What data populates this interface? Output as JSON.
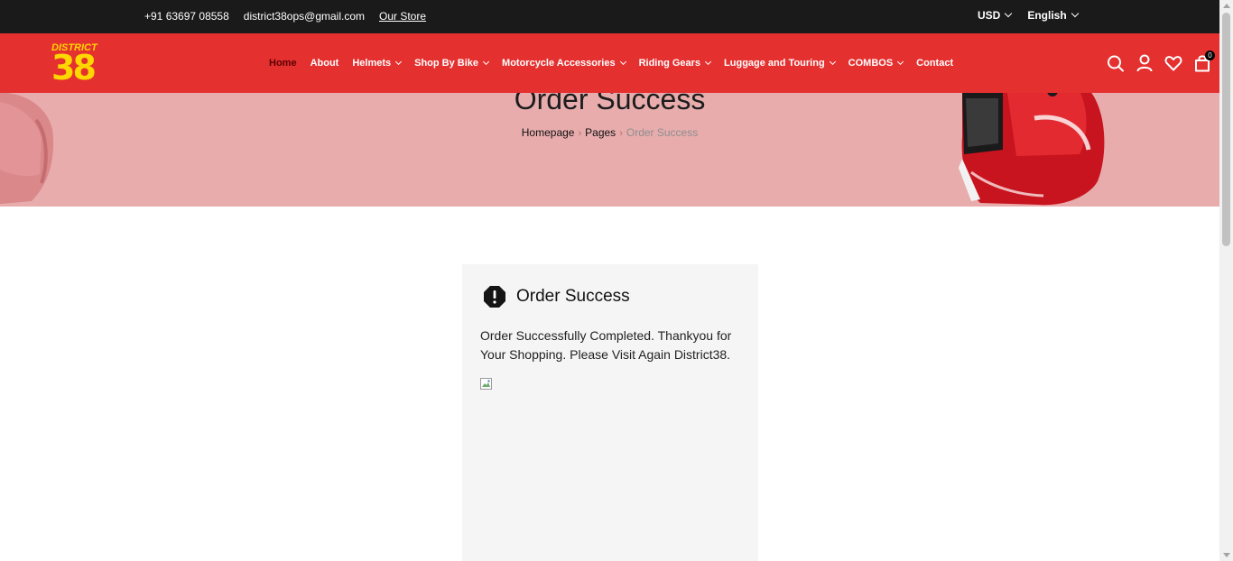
{
  "topbar": {
    "phone": "+91 63697 08558",
    "email": "district38ops@gmail.com",
    "store_link": "Our Store",
    "currency": "USD",
    "language": "English"
  },
  "header": {
    "logo_word": "DISTRICT",
    "logo_number": "38",
    "nav": [
      {
        "label": "Home",
        "dropdown": false
      },
      {
        "label": "About",
        "dropdown": false
      },
      {
        "label": "Helmets",
        "dropdown": true
      },
      {
        "label": "Shop By Bike",
        "dropdown": true
      },
      {
        "label": "Motorcycle Accessories",
        "dropdown": true
      },
      {
        "label": "Riding Gears",
        "dropdown": true
      },
      {
        "label": "Luggage and Touring",
        "dropdown": true
      },
      {
        "label": "COMBOS",
        "dropdown": true
      },
      {
        "label": "Contact",
        "dropdown": false
      }
    ],
    "icons": [
      "search-icon",
      "user-icon",
      "heart-icon",
      "cart-icon"
    ],
    "cart_count": "0"
  },
  "banner": {
    "title": "Order Success",
    "breadcrumb": [
      "Homepage",
      "Pages",
      "Order Success"
    ]
  },
  "card": {
    "title": "Order Success",
    "icon": "alert-octagon-icon",
    "message": "Order Successfully Completed. Thankyou for Your Shopping. Please Visit Again District38."
  },
  "colors": {
    "topbar": "#1a1a1a",
    "header": "#e53030",
    "banner": "#e8acad",
    "card": "#f5f5f5",
    "logo": "#ffd700"
  }
}
